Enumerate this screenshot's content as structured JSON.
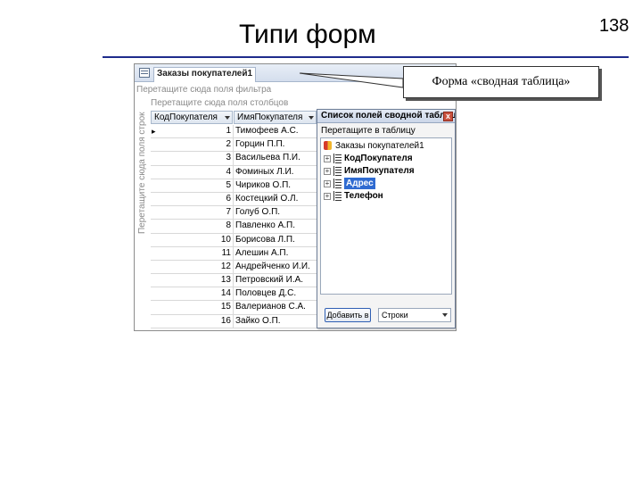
{
  "slide": {
    "title": "Типи форм",
    "page_number": "138"
  },
  "callout": {
    "text": "Форма «сводная таблица»"
  },
  "form": {
    "tab_label": "Заказы покупателей1",
    "drop_filter_hint": "Перетащите сюда поля фильтра",
    "drop_column_hint": "Перетащите сюда поля столбцов",
    "drop_row_hint": "Перетащите сюда поля строк",
    "headers": {
      "code": "КодПокупателя",
      "name": "ИмяПокупателя"
    },
    "rows": [
      {
        "code": "1",
        "name": "Тимофеев А.С."
      },
      {
        "code": "2",
        "name": "Горцин П.П."
      },
      {
        "code": "3",
        "name": "Васильева П.И."
      },
      {
        "code": "4",
        "name": "Фоминых Л.И."
      },
      {
        "code": "5",
        "name": "Чириков О.П."
      },
      {
        "code": "6",
        "name": "Костецкий О.Л."
      },
      {
        "code": "7",
        "name": "Голуб О.П."
      },
      {
        "code": "8",
        "name": "Павленко А.П."
      },
      {
        "code": "10",
        "name": "Борисова Л.П."
      },
      {
        "code": "11",
        "name": "Алешин А.П."
      },
      {
        "code": "12",
        "name": "Андрейченко И.И."
      },
      {
        "code": "13",
        "name": "Петровский И.А."
      },
      {
        "code": "14",
        "name": "Половцев Д.С."
      },
      {
        "code": "15",
        "name": "Валерианов С.А."
      },
      {
        "code": "16",
        "name": "Зайко О.П."
      }
    ]
  },
  "field_list": {
    "title": "Список полей сводной таблицы",
    "close_glyph": "x",
    "hint": "Перетащите в таблицу",
    "root": "Заказы покупателей1",
    "items": [
      {
        "label": "КодПокупателя"
      },
      {
        "label": "ИмяПокупателя"
      },
      {
        "label": "Адрес"
      },
      {
        "label": "Телефон"
      }
    ],
    "add_button": "Добавить в",
    "area_value": "Строки"
  },
  "colors": {
    "title_rule": "#1f2b8c",
    "selection": "#2f6bd1"
  }
}
